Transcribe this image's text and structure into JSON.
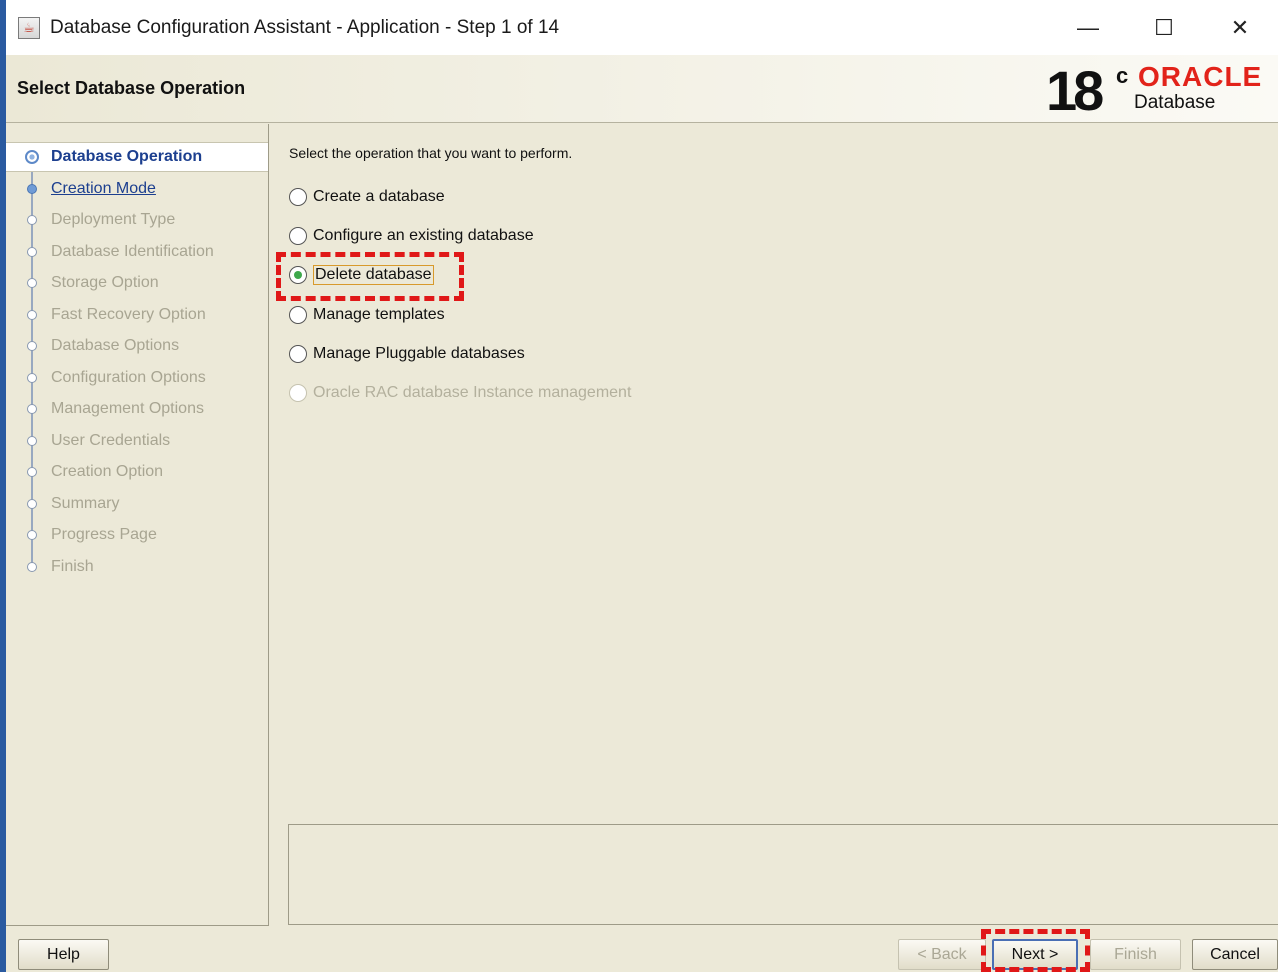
{
  "window": {
    "title": "Database Configuration Assistant - Application - Step 1 of 14",
    "app_icon": "java-icon",
    "controls": {
      "minimize": "—",
      "maximize": "☐",
      "close": "✕"
    }
  },
  "header": {
    "page_title": "Select Database Operation",
    "logo": {
      "version": "18",
      "superscript": "c",
      "brand": "ORACLE",
      "product": "Database",
      "brand_color": "#e2231a"
    }
  },
  "sidebar": {
    "steps": [
      {
        "label": "Database Operation",
        "state": "active"
      },
      {
        "label": "Creation Mode",
        "state": "link"
      },
      {
        "label": "Deployment Type",
        "state": "disabled"
      },
      {
        "label": "Database Identification",
        "state": "disabled"
      },
      {
        "label": "Storage Option",
        "state": "disabled"
      },
      {
        "label": "Fast Recovery Option",
        "state": "disabled"
      },
      {
        "label": "Database Options",
        "state": "disabled"
      },
      {
        "label": "Configuration Options",
        "state": "disabled"
      },
      {
        "label": "Management Options",
        "state": "disabled"
      },
      {
        "label": "User Credentials",
        "state": "disabled"
      },
      {
        "label": "Creation Option",
        "state": "disabled"
      },
      {
        "label": "Summary",
        "state": "disabled"
      },
      {
        "label": "Progress Page",
        "state": "disabled"
      },
      {
        "label": "Finish",
        "state": "disabled"
      }
    ]
  },
  "main": {
    "instruction": "Select the operation that you want to perform.",
    "options": [
      {
        "label": "Create a database",
        "selected": false,
        "enabled": true
      },
      {
        "label": "Configure an existing database",
        "selected": false,
        "enabled": true
      },
      {
        "label": "Delete database",
        "selected": true,
        "enabled": true
      },
      {
        "label": "Manage templates",
        "selected": false,
        "enabled": true
      },
      {
        "label": "Manage Pluggable databases",
        "selected": false,
        "enabled": true
      },
      {
        "label": "Oracle RAC database Instance management",
        "selected": false,
        "enabled": false
      }
    ]
  },
  "buttons": {
    "help": "Help",
    "back": "< Back",
    "next": "Next >",
    "finish": "Finish",
    "cancel": "Cancel"
  },
  "accent_colors": {
    "highlight": "#e01818",
    "selected_radio": "#3ea84b",
    "link": "#1c3f8f"
  }
}
